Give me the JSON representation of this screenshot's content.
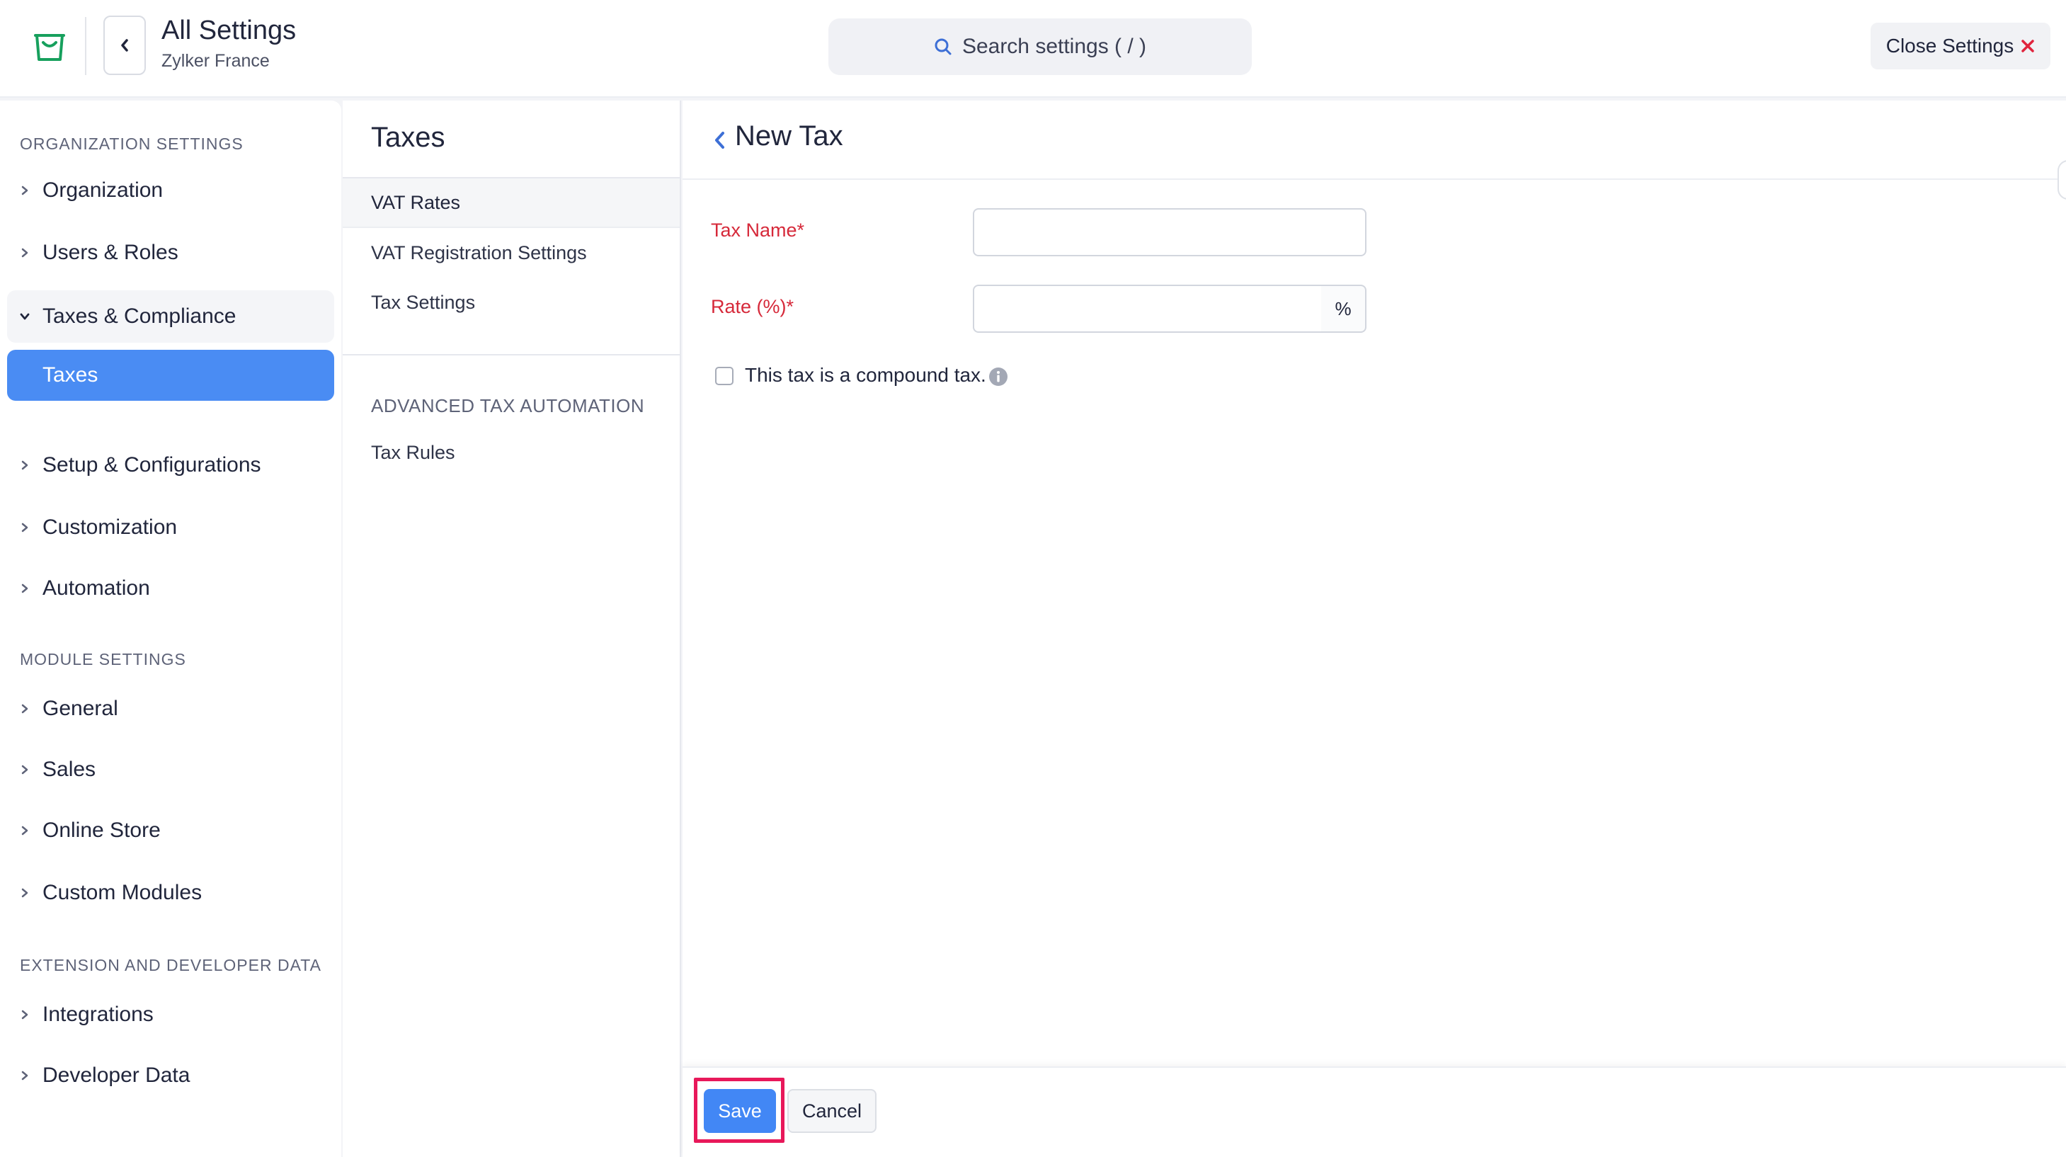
{
  "header": {
    "app_title": "All Settings",
    "org_name": "Zylker France",
    "search_placeholder": "Search settings ( / )",
    "close_label": "Close Settings",
    "accent_color": "#4a8cf3",
    "close_icon_color": "#e0243d"
  },
  "sidebar": {
    "sections": [
      {
        "heading": "ORGANIZATION SETTINGS",
        "items": [
          {
            "label": "Organization"
          },
          {
            "label": "Users & Roles"
          },
          {
            "label": "Taxes & Compliance",
            "expanded": true,
            "children": [
              {
                "label": "Taxes",
                "active": true
              }
            ]
          },
          {
            "label": "Setup & Configurations"
          },
          {
            "label": "Customization"
          },
          {
            "label": "Automation"
          }
        ]
      },
      {
        "heading": "MODULE SETTINGS",
        "items": [
          {
            "label": "General"
          },
          {
            "label": "Sales"
          },
          {
            "label": "Online Store"
          },
          {
            "label": "Custom Modules"
          }
        ]
      },
      {
        "heading": "EXTENSION AND DEVELOPER DATA",
        "items": [
          {
            "label": "Integrations"
          },
          {
            "label": "Developer Data"
          }
        ]
      }
    ]
  },
  "middle": {
    "title": "Taxes",
    "items": [
      {
        "label": "VAT Rates",
        "selected": true
      },
      {
        "label": "VAT Registration Settings"
      },
      {
        "label": "Tax Settings"
      }
    ],
    "advanced_heading": "ADVANCED TAX AUTOMATION",
    "advanced_items": [
      {
        "label": "Tax Rules"
      }
    ]
  },
  "form": {
    "title": "New Tax",
    "tax_name_label": "Tax Name*",
    "tax_name_value": "",
    "rate_label": "Rate (%)*",
    "rate_value": "",
    "rate_suffix": "%",
    "compound_label": "This tax is a compound tax.",
    "compound_checked": false,
    "save_label": "Save",
    "cancel_label": "Cancel"
  }
}
